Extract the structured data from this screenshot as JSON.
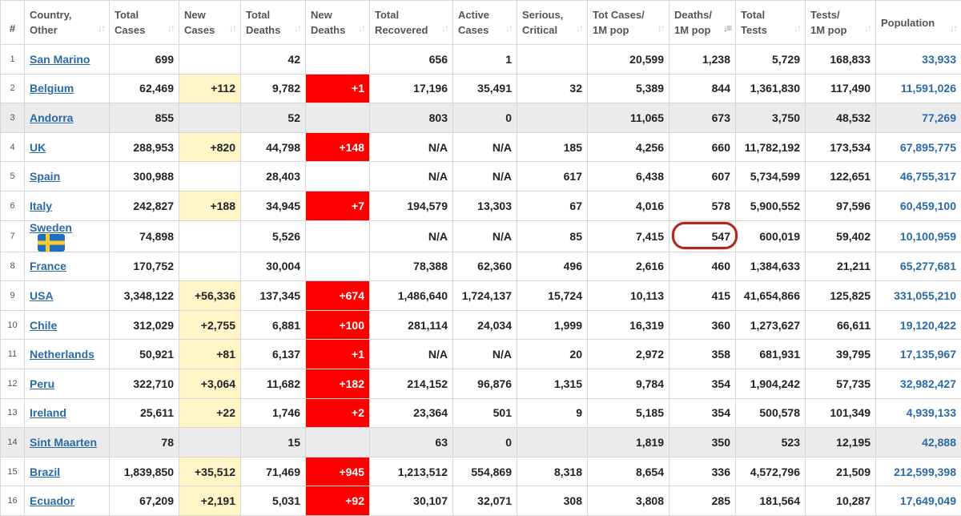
{
  "table": {
    "headers": {
      "idx": "#",
      "country_l1": "Country,",
      "country_l2": "Other",
      "total_cases_l1": "Total",
      "total_cases_l2": "Cases",
      "new_cases_l1": "New",
      "new_cases_l2": "Cases",
      "total_deaths_l1": "Total",
      "total_deaths_l2": "Deaths",
      "new_deaths_l1": "New",
      "new_deaths_l2": "Deaths",
      "total_recovered_l1": "Total",
      "total_recovered_l2": "Recovered",
      "active_l1": "Active",
      "active_l2": "Cases",
      "serious_l1": "Serious,",
      "serious_l2": "Critical",
      "totcases_pm_l1": "Tot Cases/",
      "totcases_pm_l2": "1M pop",
      "deaths_pm_l1": "Deaths/",
      "deaths_pm_l2": "1M pop",
      "total_tests_l1": "Total",
      "total_tests_l2": "Tests",
      "tests_pm_l1": "Tests/",
      "tests_pm_l2": "1M pop",
      "population": "Population"
    },
    "sort_icon": "↓↑",
    "active_sort_icon": "↓≡",
    "rows": [
      {
        "idx": "1",
        "country": "San Marino",
        "total_cases": "699",
        "new_cases": "",
        "total_deaths": "42",
        "new_deaths": "",
        "total_recovered": "656",
        "active": "1",
        "serious": "",
        "totcases_pm": "20,599",
        "deaths_pm": "1,238",
        "total_tests": "5,729",
        "tests_pm": "168,833",
        "population": "33,933",
        "grey": false
      },
      {
        "idx": "2",
        "country": "Belgium",
        "total_cases": "62,469",
        "new_cases": "+112",
        "total_deaths": "9,782",
        "new_deaths": "+1",
        "total_recovered": "17,196",
        "active": "35,491",
        "serious": "32",
        "totcases_pm": "5,389",
        "deaths_pm": "844",
        "total_tests": "1,361,830",
        "tests_pm": "117,490",
        "population": "11,591,026",
        "grey": false
      },
      {
        "idx": "3",
        "country": "Andorra",
        "total_cases": "855",
        "new_cases": "",
        "total_deaths": "52",
        "new_deaths": "",
        "total_recovered": "803",
        "active": "0",
        "serious": "",
        "totcases_pm": "11,065",
        "deaths_pm": "673",
        "total_tests": "3,750",
        "tests_pm": "48,532",
        "population": "77,269",
        "grey": true
      },
      {
        "idx": "4",
        "country": "UK",
        "total_cases": "288,953",
        "new_cases": "+820",
        "total_deaths": "44,798",
        "new_deaths": "+148",
        "total_recovered": "N/A",
        "active": "N/A",
        "serious": "185",
        "totcases_pm": "4,256",
        "deaths_pm": "660",
        "total_tests": "11,782,192",
        "tests_pm": "173,534",
        "population": "67,895,775",
        "grey": false
      },
      {
        "idx": "5",
        "country": "Spain",
        "total_cases": "300,988",
        "new_cases": "",
        "total_deaths": "28,403",
        "new_deaths": "",
        "total_recovered": "N/A",
        "active": "N/A",
        "serious": "617",
        "totcases_pm": "6,438",
        "deaths_pm": "607",
        "total_tests": "5,734,599",
        "tests_pm": "122,651",
        "population": "46,755,317",
        "grey": false
      },
      {
        "idx": "6",
        "country": "Italy",
        "total_cases": "242,827",
        "new_cases": "+188",
        "total_deaths": "34,945",
        "new_deaths": "+7",
        "total_recovered": "194,579",
        "active": "13,303",
        "serious": "67",
        "totcases_pm": "4,016",
        "deaths_pm": "578",
        "total_tests": "5,900,552",
        "tests_pm": "97,596",
        "population": "60,459,100",
        "grey": false
      },
      {
        "idx": "7",
        "country": "Sweden",
        "total_cases": "74,898",
        "new_cases": "",
        "total_deaths": "5,526",
        "new_deaths": "",
        "total_recovered": "N/A",
        "active": "N/A",
        "serious": "85",
        "totcases_pm": "7,415",
        "deaths_pm": "547",
        "total_tests": "600,019",
        "tests_pm": "59,402",
        "population": "10,100,959",
        "grey": false,
        "flag": true,
        "circled": true
      },
      {
        "idx": "8",
        "country": "France",
        "total_cases": "170,752",
        "new_cases": "",
        "total_deaths": "30,004",
        "new_deaths": "",
        "total_recovered": "78,388",
        "active": "62,360",
        "serious": "496",
        "totcases_pm": "2,616",
        "deaths_pm": "460",
        "total_tests": "1,384,633",
        "tests_pm": "21,211",
        "population": "65,277,681",
        "grey": false
      },
      {
        "idx": "9",
        "country": "USA",
        "total_cases": "3,348,122",
        "new_cases": "+56,336",
        "total_deaths": "137,345",
        "new_deaths": "+674",
        "total_recovered": "1,486,640",
        "active": "1,724,137",
        "serious": "15,724",
        "totcases_pm": "10,113",
        "deaths_pm": "415",
        "total_tests": "41,654,866",
        "tests_pm": "125,825",
        "population": "331,055,210",
        "grey": false
      },
      {
        "idx": "10",
        "country": "Chile",
        "total_cases": "312,029",
        "new_cases": "+2,755",
        "total_deaths": "6,881",
        "new_deaths": "+100",
        "total_recovered": "281,114",
        "active": "24,034",
        "serious": "1,999",
        "totcases_pm": "16,319",
        "deaths_pm": "360",
        "total_tests": "1,273,627",
        "tests_pm": "66,611",
        "population": "19,120,422",
        "grey": false
      },
      {
        "idx": "11",
        "country": "Netherlands",
        "total_cases": "50,921",
        "new_cases": "+81",
        "total_deaths": "6,137",
        "new_deaths": "+1",
        "total_recovered": "N/A",
        "active": "N/A",
        "serious": "20",
        "totcases_pm": "2,972",
        "deaths_pm": "358",
        "total_tests": "681,931",
        "tests_pm": "39,795",
        "population": "17,135,967",
        "grey": false
      },
      {
        "idx": "12",
        "country": "Peru",
        "total_cases": "322,710",
        "new_cases": "+3,064",
        "total_deaths": "11,682",
        "new_deaths": "+182",
        "total_recovered": "214,152",
        "active": "96,876",
        "serious": "1,315",
        "totcases_pm": "9,784",
        "deaths_pm": "354",
        "total_tests": "1,904,242",
        "tests_pm": "57,735",
        "population": "32,982,427",
        "grey": false
      },
      {
        "idx": "13",
        "country": "Ireland",
        "total_cases": "25,611",
        "new_cases": "+22",
        "total_deaths": "1,746",
        "new_deaths": "+2",
        "total_recovered": "23,364",
        "active": "501",
        "serious": "9",
        "totcases_pm": "5,185",
        "deaths_pm": "354",
        "total_tests": "500,578",
        "tests_pm": "101,349",
        "population": "4,939,133",
        "grey": false
      },
      {
        "idx": "14",
        "country": "Sint Maarten",
        "total_cases": "78",
        "new_cases": "",
        "total_deaths": "15",
        "new_deaths": "",
        "total_recovered": "63",
        "active": "0",
        "serious": "",
        "totcases_pm": "1,819",
        "deaths_pm": "350",
        "total_tests": "523",
        "tests_pm": "12,195",
        "population": "42,888",
        "grey": true
      },
      {
        "idx": "15",
        "country": "Brazil",
        "total_cases": "1,839,850",
        "new_cases": "+35,512",
        "total_deaths": "71,469",
        "new_deaths": "+945",
        "total_recovered": "1,213,512",
        "active": "554,869",
        "serious": "8,318",
        "totcases_pm": "8,654",
        "deaths_pm": "336",
        "total_tests": "4,572,796",
        "tests_pm": "21,509",
        "population": "212,599,398",
        "grey": false
      },
      {
        "idx": "16",
        "country": "Ecuador",
        "total_cases": "67,209",
        "new_cases": "+2,191",
        "total_deaths": "5,031",
        "new_deaths": "+92",
        "total_recovered": "30,107",
        "active": "32,071",
        "serious": "308",
        "totcases_pm": "3,808",
        "deaths_pm": "285",
        "total_tests": "181,564",
        "tests_pm": "10,287",
        "population": "17,649,049",
        "grey": false
      }
    ]
  },
  "colors": {
    "new_cases_bg": "#fff5c7",
    "new_deaths_bg": "#ff0000",
    "link": "#2a6aa6",
    "grey_row": "#ebebeb",
    "highlight_circle": "#b3271b"
  },
  "annotations": {
    "flag_icon": "sweden-flag-icon",
    "highlight": "hand-drawn-circle around Sweden deaths per 1M"
  }
}
